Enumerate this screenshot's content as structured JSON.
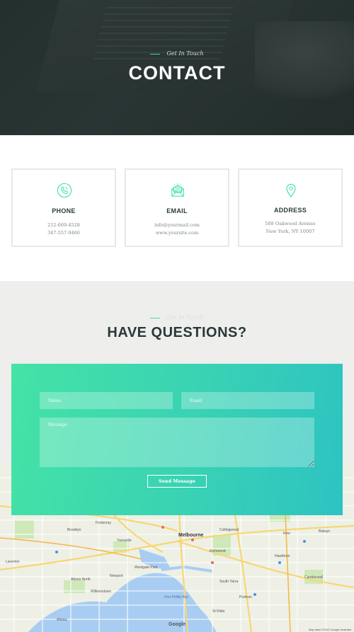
{
  "hero": {
    "eyebrow": "Get In Touch",
    "title": "CONTACT"
  },
  "cards": [
    {
      "icon": "phone-icon",
      "title": "PHONE",
      "line1": "212-669-4528",
      "line2": "347-557-9466"
    },
    {
      "icon": "envelope-icon",
      "title": "EMAIL",
      "line1": "info@yourmail.com",
      "line2": "www.yoursite.com"
    },
    {
      "icon": "location-pin-icon",
      "title": "ADDRESS",
      "line1": "588 Oakwood Avenue",
      "line2": "New York, NY 10007"
    }
  ],
  "questions": {
    "eyebrow": "Get In Touch",
    "title": "HAVE QUESTIONS?"
  },
  "form": {
    "name_placeholder": "Name",
    "email_placeholder": "Email",
    "message_placeholder": "Message",
    "send_label": "Send Message"
  },
  "map": {
    "logo": "Google",
    "attribution": "Map data ©2019 Google   Australia",
    "labels": [
      "Melbourne",
      "Footscray",
      "Brooklyn",
      "Yarraville",
      "Williamstown",
      "Altona",
      "Newport",
      "South Yarra",
      "St Kilda",
      "Hawthorn",
      "Richmond",
      "Collingwood",
      "Prahran",
      "Kew",
      "Balwyn",
      "Camberwell",
      "Altona North",
      "Laverton",
      "Westgate Park",
      "Port Phillip Bay"
    ]
  },
  "colors": {
    "accent": "#3ee0a8",
    "gradient_start": "#44e3a5",
    "gradient_end": "#2dc3c2",
    "dark_text": "#2a3838"
  }
}
